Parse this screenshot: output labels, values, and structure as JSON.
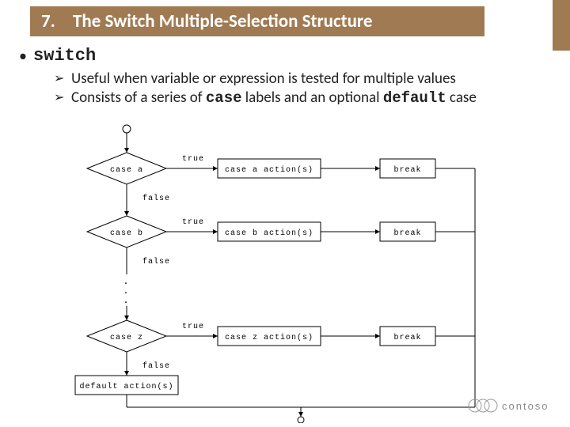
{
  "title": {
    "num": "7.",
    "text": "The Switch Multiple-Selection Structure"
  },
  "bullet": {
    "keyword": "switch"
  },
  "subs": [
    {
      "text_before": "Useful when variable or expression is tested for multiple values",
      "code1": "",
      "mid": "",
      "code2": "",
      "after": ""
    },
    {
      "text_before": "Consists of a series of ",
      "code1": "case",
      "mid": " labels and an optional ",
      "code2": "default",
      "after": " case"
    }
  ],
  "flow": {
    "true": "true",
    "false": "false",
    "cases": [
      {
        "label": "case a",
        "action": "case a action(s)",
        "brk": "break"
      },
      {
        "label": "case b",
        "action": "case b action(s)",
        "brk": "break"
      },
      {
        "label": "case z",
        "action": "case z action(s)",
        "brk": "break"
      }
    ],
    "default": "default action(s)"
  },
  "brand": "contoso"
}
